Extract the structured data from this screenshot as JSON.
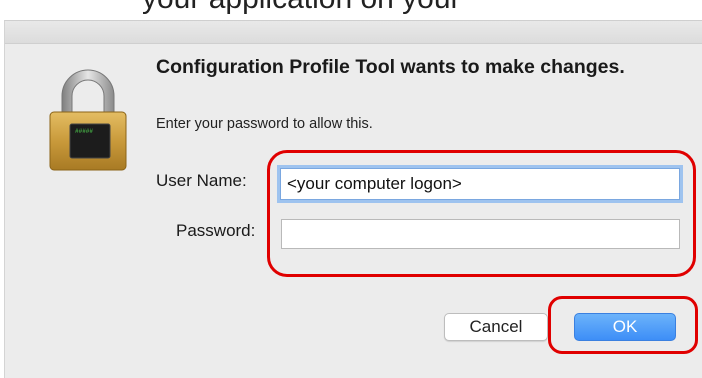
{
  "background": {
    "partial_text": "your application on your "
  },
  "dialog": {
    "title": "Configuration Profile Tool wants to make changes.",
    "message": "Enter your password to allow this.",
    "icon": "lock-icon",
    "lock_screen_text": "#####"
  },
  "form": {
    "username_label": "User Name:",
    "username_value": "<your computer logon>",
    "password_label": "Password:",
    "password_value": ""
  },
  "buttons": {
    "cancel_label": "Cancel",
    "ok_label": "OK"
  },
  "colors": {
    "highlight": "#e00000",
    "ok_button": "#3d8ef7",
    "focus_ring": "#9ec3ef"
  }
}
